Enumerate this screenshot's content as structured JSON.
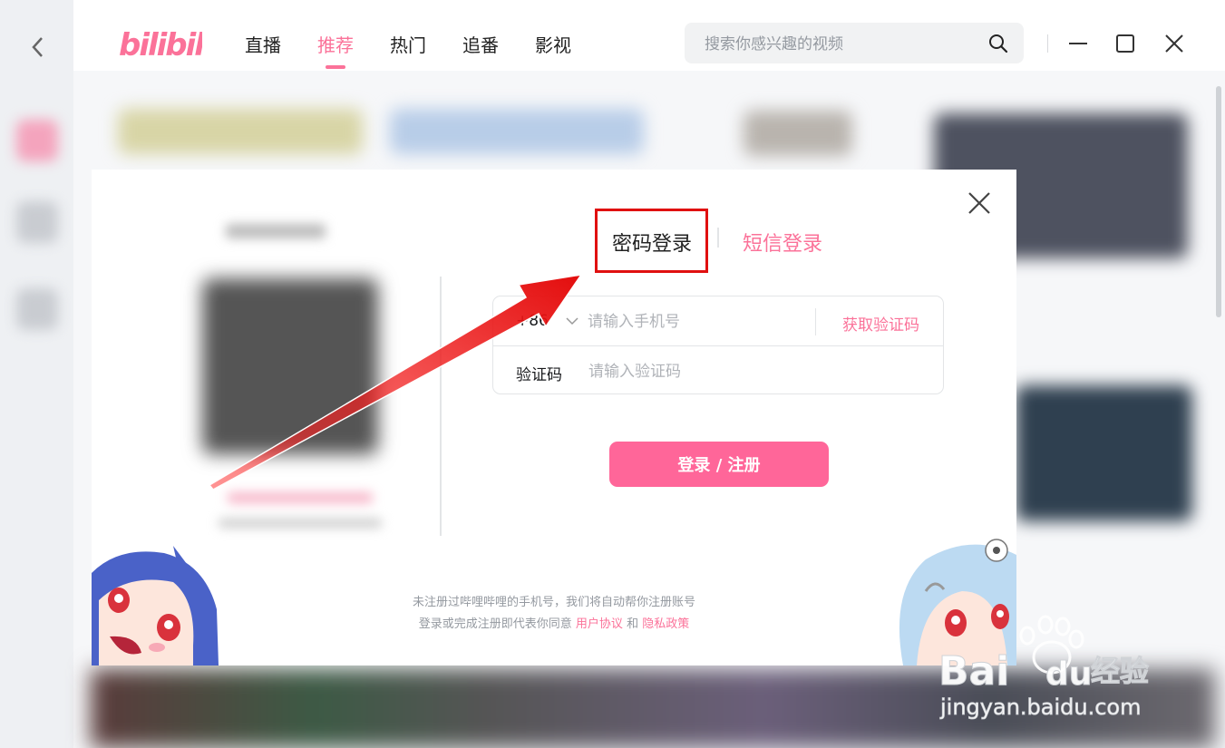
{
  "topbar": {
    "logo_text": "bilibili",
    "nav": [
      {
        "label": "直播",
        "active": false
      },
      {
        "label": "推荐",
        "active": true
      },
      {
        "label": "热门",
        "active": false
      },
      {
        "label": "追番",
        "active": false
      },
      {
        "label": "影视",
        "active": false
      }
    ],
    "search": {
      "placeholder": "搜索你感兴趣的视频",
      "icon": "search-icon"
    }
  },
  "login_modal": {
    "tabs": {
      "password": "密码登录",
      "sms": "短信登录",
      "highlighted": "密码登录"
    },
    "form": {
      "country_code": "+86",
      "phone_placeholder": "请输入手机号",
      "get_code": "获取验证码",
      "code_label": "验证码",
      "code_placeholder": "请输入验证码"
    },
    "submit_label": "登录 / 注册",
    "notice": {
      "line1": "未注册过哔哩哔哩的手机号，我们将自动帮你注册账号",
      "line2_prefix": "登录或完成注册即代表你同意",
      "user_agreement": "用户协议",
      "and": "和",
      "privacy_policy": "隐私政策"
    }
  },
  "watermark": {
    "brand": "Bai",
    "brand2": "du",
    "product": "经验",
    "url": "jingyan.baidu.com"
  },
  "colors": {
    "accent": "#fb7299",
    "button": "#ff6699",
    "annotation": "#e01010"
  }
}
